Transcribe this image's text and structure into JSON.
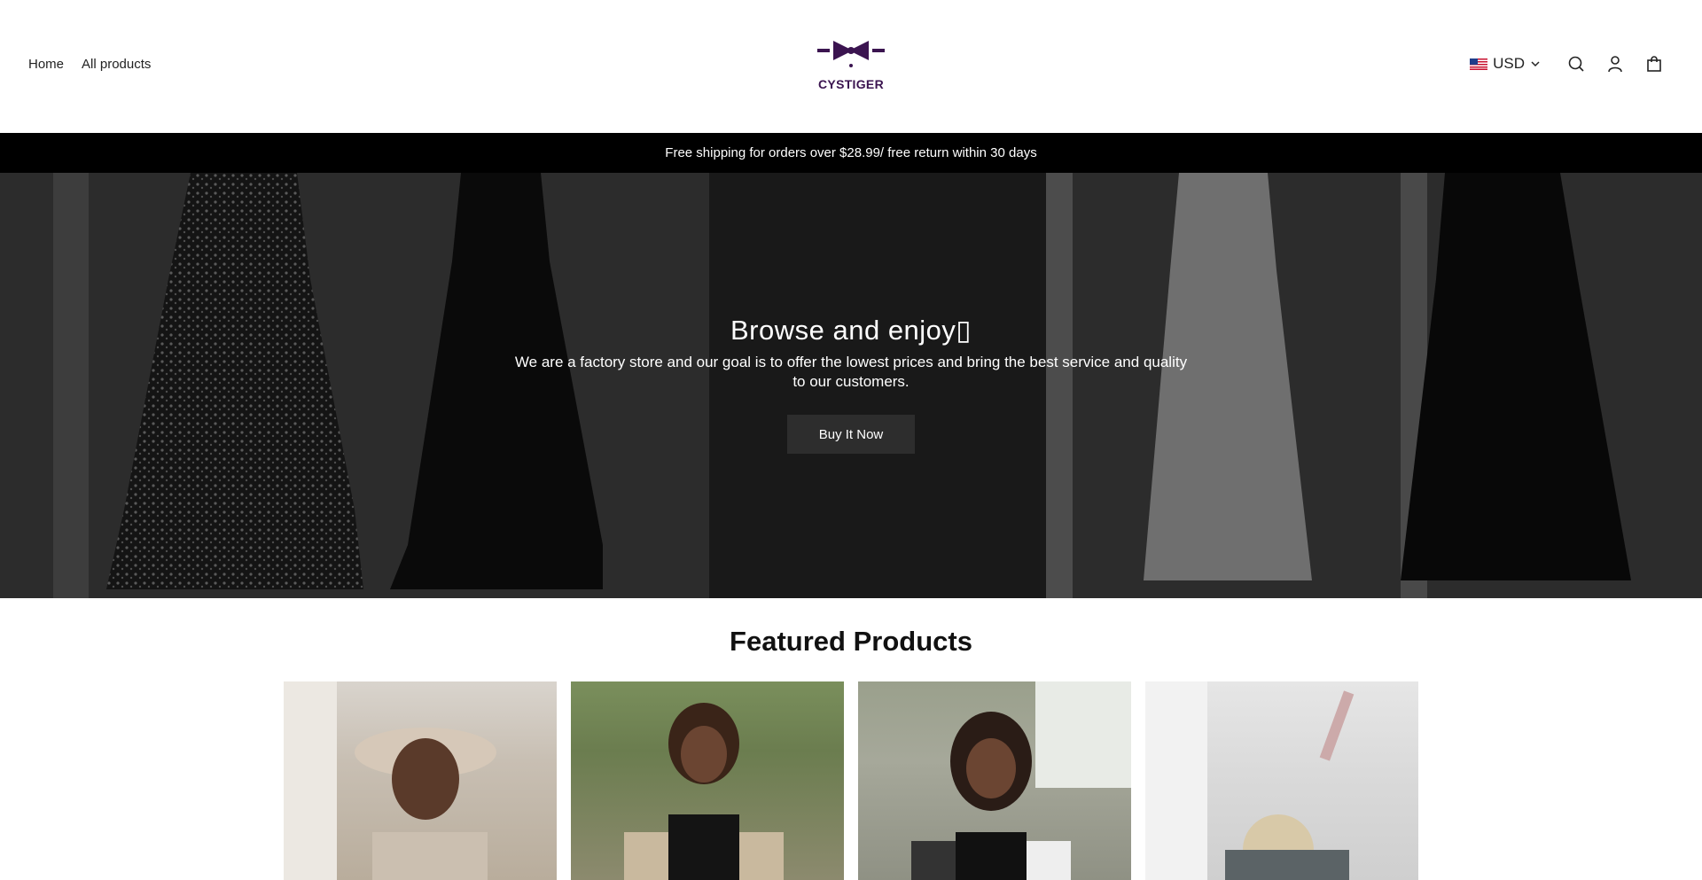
{
  "header": {
    "nav": [
      {
        "label": "Home"
      },
      {
        "label": "All products"
      }
    ],
    "logo_text": "CYSTIGER",
    "currency": "USD",
    "icons": [
      "search-icon",
      "account-icon",
      "cart-icon"
    ]
  },
  "announcement": "Free shipping for orders over $28.99/ free return within 30 days",
  "hero": {
    "title": "Browse and enjoy▯",
    "description": "We are a factory store and our goal is to offer the lowest prices and bring the best service and quality to our customers.",
    "button": "Buy It Now"
  },
  "featured": {
    "title": "Featured Products",
    "products": 4
  },
  "colors": {
    "brand": "#3b1450",
    "announce_bg": "#000000",
    "button_bg": "#2d2d2d"
  }
}
